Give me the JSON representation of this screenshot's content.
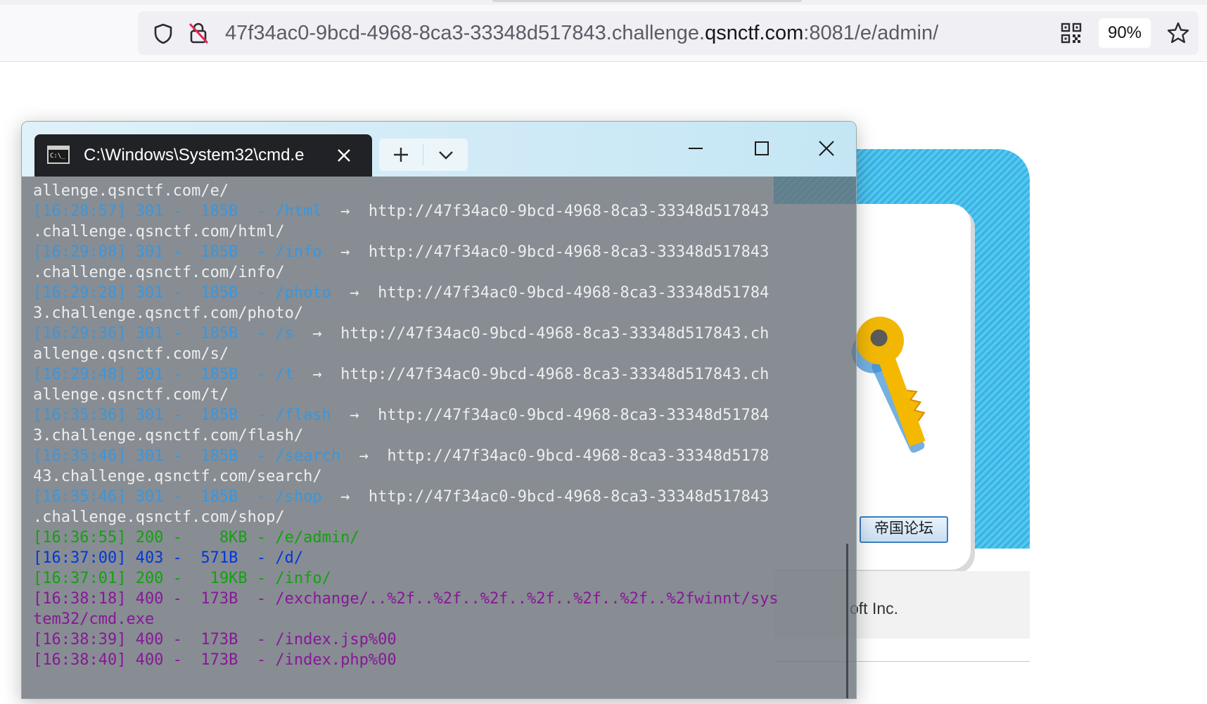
{
  "browser": {
    "url_prefix": "47f34ac0-9bcd-4968-8ca3-33348d517843.challenge.",
    "url_domain": "qsnctf.com",
    "url_suffix": ":8081/e/admin/",
    "zoom": "90%"
  },
  "terminal": {
    "tab_title": "C:\\Windows\\System32\\cmd.e",
    "new_tab_label": "+",
    "colors": {
      "white": "#eeeeee",
      "cyan": "#3a96dd",
      "green": "#13a10e",
      "blue": "#0037da",
      "purple": "#881798"
    },
    "lines": [
      {
        "segments": [
          {
            "text": "allenge.qsnctf.com/e/",
            "color": "white"
          }
        ]
      },
      {
        "segments": [
          {
            "text": "[16:28:57] 301 -  185B  - /html",
            "color": "cyan"
          },
          {
            "text": "  →  http://47f34ac0-9bcd-4968-8ca3-33348d517843",
            "color": "white"
          }
        ]
      },
      {
        "segments": [
          {
            "text": ".challenge.qsnctf.com/html/",
            "color": "white"
          }
        ]
      },
      {
        "segments": [
          {
            "text": "[16:29:08] 301 -  185B  - /info",
            "color": "cyan"
          },
          {
            "text": "  →  http://47f34ac0-9bcd-4968-8ca3-33348d517843",
            "color": "white"
          }
        ]
      },
      {
        "segments": [
          {
            "text": ".challenge.qsnctf.com/info/",
            "color": "white"
          }
        ]
      },
      {
        "segments": [
          {
            "text": "[16:29:28] 301 -  185B  - /photo",
            "color": "cyan"
          },
          {
            "text": "  →  http://47f34ac0-9bcd-4968-8ca3-33348d51784",
            "color": "white"
          }
        ]
      },
      {
        "segments": [
          {
            "text": "3.challenge.qsnctf.com/photo/",
            "color": "white"
          }
        ]
      },
      {
        "segments": [
          {
            "text": "[16:29:36] 301 -  185B  - /s",
            "color": "cyan"
          },
          {
            "text": "  →  http://47f34ac0-9bcd-4968-8ca3-33348d517843.ch",
            "color": "white"
          }
        ]
      },
      {
        "segments": [
          {
            "text": "allenge.qsnctf.com/s/",
            "color": "white"
          }
        ]
      },
      {
        "segments": [
          {
            "text": "[16:29:48] 301 -  185B  - /t",
            "color": "cyan"
          },
          {
            "text": "  →  http://47f34ac0-9bcd-4968-8ca3-33348d517843.ch",
            "color": "white"
          }
        ]
      },
      {
        "segments": [
          {
            "text": "allenge.qsnctf.com/t/",
            "color": "white"
          }
        ]
      },
      {
        "segments": [
          {
            "text": "[16:35:36] 301 -  185B  - /flash",
            "color": "cyan"
          },
          {
            "text": "  →  http://47f34ac0-9bcd-4968-8ca3-33348d51784",
            "color": "white"
          }
        ]
      },
      {
        "segments": [
          {
            "text": "3.challenge.qsnctf.com/flash/",
            "color": "white"
          }
        ]
      },
      {
        "segments": [
          {
            "text": "[16:35:46] 301 -  185B  - /search",
            "color": "cyan"
          },
          {
            "text": "  →  http://47f34ac0-9bcd-4968-8ca3-33348d5178",
            "color": "white"
          }
        ]
      },
      {
        "segments": [
          {
            "text": "43.challenge.qsnctf.com/search/",
            "color": "white"
          }
        ]
      },
      {
        "segments": [
          {
            "text": "[16:35:46] 301 -  185B  - /shop",
            "color": "cyan"
          },
          {
            "text": "  →  http://47f34ac0-9bcd-4968-8ca3-33348d517843",
            "color": "white"
          }
        ]
      },
      {
        "segments": [
          {
            "text": ".challenge.qsnctf.com/shop/",
            "color": "white"
          }
        ]
      },
      {
        "segments": [
          {
            "text": "[16:36:55] 200 -    8KB - /e/admin/",
            "color": "green"
          }
        ]
      },
      {
        "segments": [
          {
            "text": "[16:37:00] 403 -  571B  - /d/",
            "color": "blue"
          }
        ]
      },
      {
        "segments": [
          {
            "text": "[16:37:01] 200 -   19KB - /info/",
            "color": "green"
          }
        ]
      },
      {
        "segments": [
          {
            "text": "[16:38:18] 400 -  173B  - /exchange/..%2f..%2f..%2f..%2f..%2f..%2f..%2fwinnt/sys",
            "color": "purple"
          }
        ]
      },
      {
        "segments": [
          {
            "text": "tem32/cmd.exe",
            "color": "purple"
          }
        ]
      },
      {
        "segments": [
          {
            "text": "[16:38:39] 400 -  173B  - /index.jsp%00",
            "color": "purple"
          }
        ]
      },
      {
        "segments": [
          {
            "text": "[16:38:40] 400 -  173B  - /index.php%00",
            "color": "purple"
          }
        ]
      }
    ]
  },
  "background_site": {
    "forum_button": "帝国论坛",
    "copyright": "oft Inc."
  }
}
